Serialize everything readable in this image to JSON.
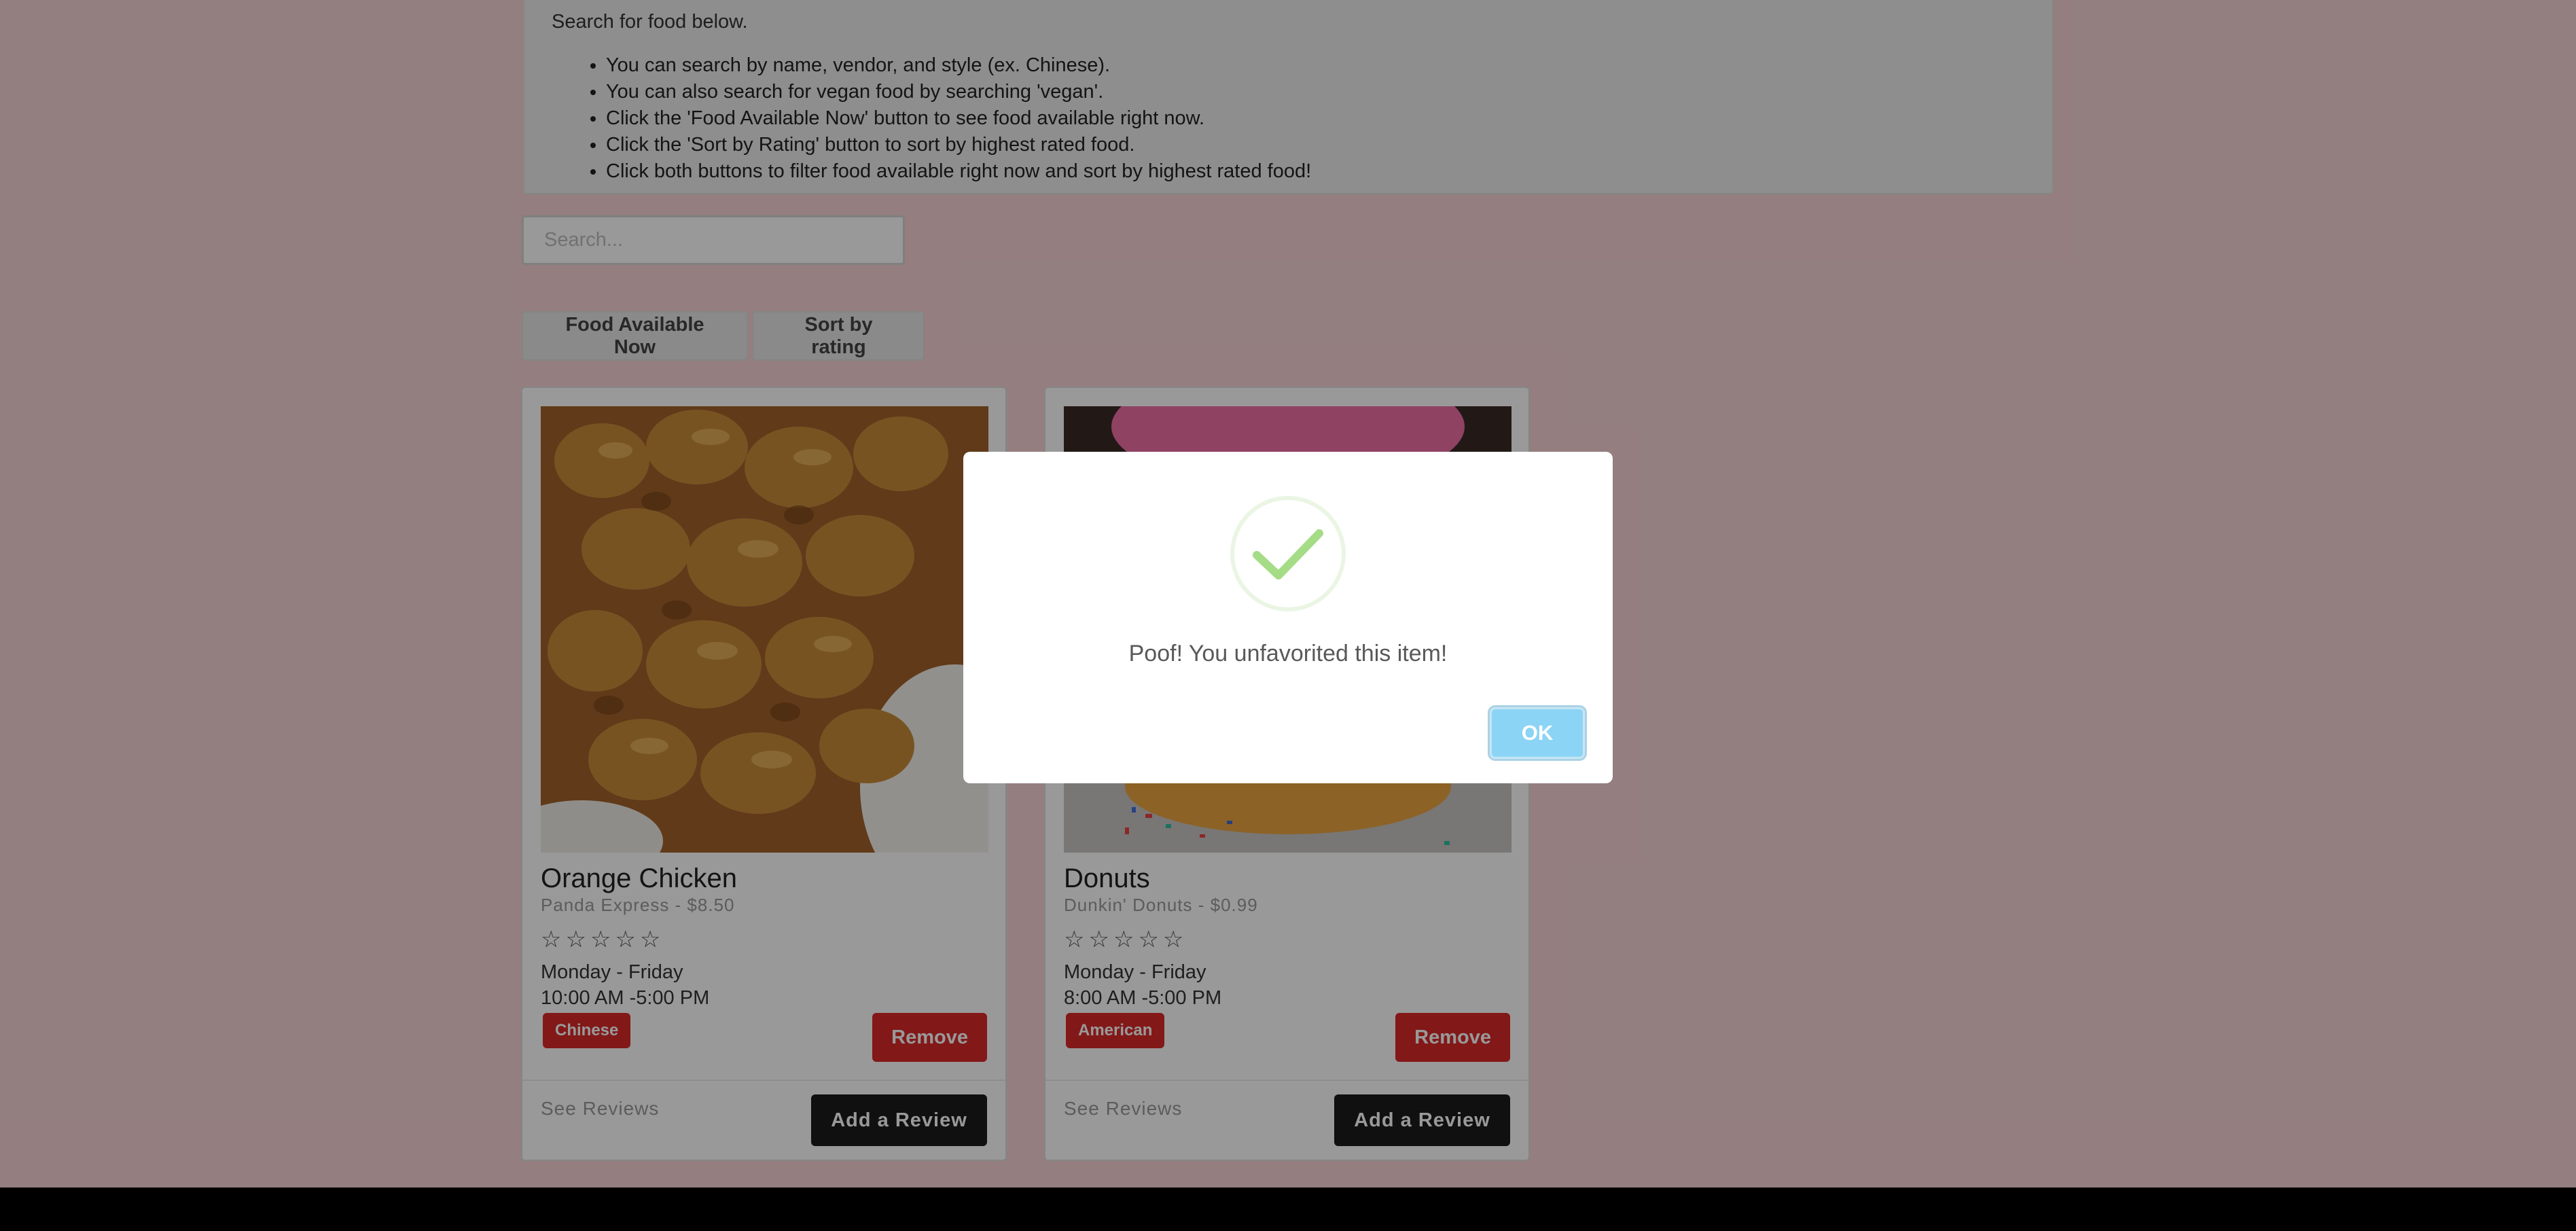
{
  "instructions": {
    "intro": "Search for food below.",
    "items": [
      "You can search by name, vendor, and style (ex. Chinese).",
      "You can also search for vegan food by searching 'vegan'.",
      "Click the 'Food Available Now' button to see food available right now.",
      "Click the 'Sort by Rating' button to sort by highest rated food.",
      "Click both buttons to filter food available right now and sort by highest rated food!"
    ]
  },
  "search": {
    "placeholder": "Search..."
  },
  "filters": {
    "available_now": "Food Available Now",
    "sort_rating": "Sort by rating"
  },
  "cards": [
    {
      "title": "Orange Chicken",
      "meta": "Panda Express - $8.50",
      "stars": "☆☆☆☆☆",
      "days": "Monday - Friday",
      "hours": "10:00 AM -5:00 PM",
      "tag": "Chinese",
      "remove": "Remove",
      "see_reviews": "See Reviews",
      "add_review": "Add a Review"
    },
    {
      "title": "Donuts",
      "meta": "Dunkin' Donuts - $0.99",
      "stars": "☆☆☆☆☆",
      "days": "Monday - Friday",
      "hours": "8:00 AM -5:00 PM",
      "tag": "American",
      "remove": "Remove",
      "see_reviews": "See Reviews",
      "add_review": "Add a Review"
    }
  ],
  "modal": {
    "message": "Poof! You unfavorited this item!",
    "ok": "OK"
  },
  "colors": {
    "background": "#f7d3d6",
    "danger": "#db2828",
    "dark_button": "#1b1c1d",
    "ok_button": "#8cd4f5",
    "success_check": "#a5dc86"
  }
}
